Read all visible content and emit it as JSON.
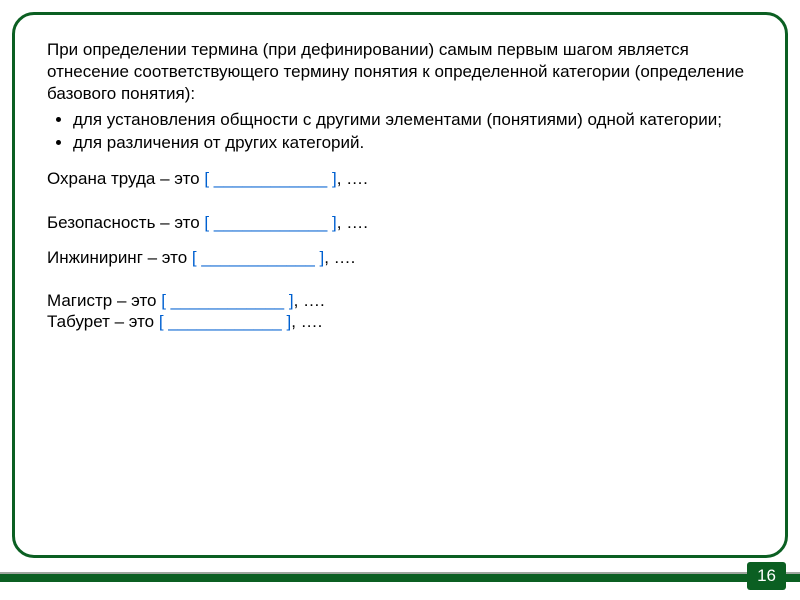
{
  "colors": {
    "frame_border": "#0b5f22",
    "bracket_text": "#0060d0",
    "footer_bar": "#0b5f22",
    "footer_accent": "#9fa69f",
    "page_number_bg": "#0b5f22",
    "page_number_fg": "#ffffff"
  },
  "intro": "При определении термина (при дефинировании) самым первым шагом является отнесение соответствующего термину понятия к определенной категории (определение базового понятия):",
  "bullets": [
    "для установления общности с другими элементами (понятиями) одной категории;",
    "для различения от других категорий."
  ],
  "examples": [
    {
      "label": "Охрана труда – это ",
      "bracket": "[ ____________  ]",
      "tail": ", …."
    },
    {
      "label": "Безопасность – это ",
      "bracket": "[ ____________  ]",
      "tail": ", …."
    },
    {
      "label": "Инжиниринг – это ",
      "bracket": "[ ____________  ]",
      "tail": ", …."
    },
    {
      "label": "Магистр – это ",
      "bracket": "[ ____________  ]",
      "tail": ", …."
    },
    {
      "label": "Табурет – это ",
      "bracket": "[ ____________  ]",
      "tail": ", …."
    }
  ],
  "page_number": "16"
}
